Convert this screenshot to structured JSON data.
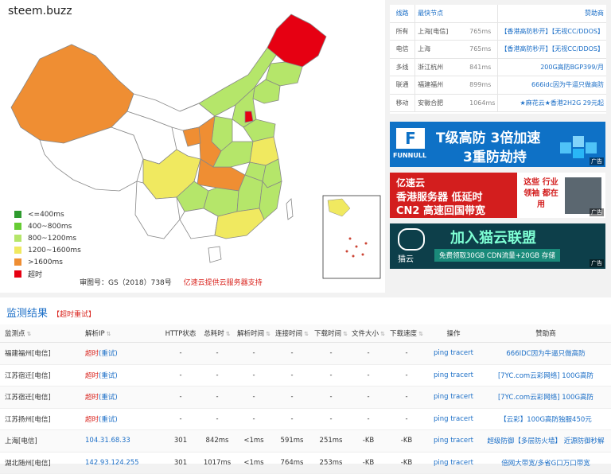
{
  "site": {
    "title": "steem.buzz"
  },
  "legend": [
    {
      "label": "<=400ms",
      "color": "#2e9b2e"
    },
    {
      "label": "400~800ms",
      "color": "#66cc33"
    },
    {
      "label": "800~1200ms",
      "color": "#b5e66a"
    },
    {
      "label": "1200~1600ms",
      "color": "#f0e960"
    },
    {
      "label": ">1600ms",
      "color": "#ef8e33"
    },
    {
      "label": "超时",
      "color": "#e60012"
    }
  ],
  "map_footer": {
    "license": "审图号：GS（2018）738号",
    "sponsor": "亿速云提供云服务器支持"
  },
  "lines_table": {
    "header": {
      "line": "线路",
      "node": "最快节点",
      "sponsor": "赞助商"
    },
    "rows": [
      {
        "line": "所有",
        "node": "上海[电信]",
        "time": "765ms",
        "sponsor": "【香港高防秒开】【无视CC/DDOS】"
      },
      {
        "line": "电信",
        "node": "上海",
        "time": "765ms",
        "sponsor": "【香港高防秒开】【无视CC/DDOS】"
      },
      {
        "line": "多线",
        "node": "浙江杭州",
        "time": "841ms",
        "sponsor": "200G高防BGP399/月"
      },
      {
        "line": "联通",
        "node": "福建福州",
        "time": "899ms",
        "sponsor": "666idc因为牛逼只做高防"
      },
      {
        "line": "移动",
        "node": "安徽合肥",
        "time": "1064ms",
        "sponsor": "★麻花云★香港2H2G 29元起"
      }
    ]
  },
  "ads": [
    {
      "brand": "FUNNULL",
      "headline": "T级高防  3倍加速",
      "sub": "3重防劫持",
      "tag": "广告"
    },
    {
      "brand": "亿速云",
      "headline": "香港服务器 低延时",
      "sub": "CN2 高速回国带宽",
      "side": "这些 行业领袖 都在用",
      "tag": "广告"
    },
    {
      "brand": "猫云",
      "headline": "加入猫云联盟",
      "sub": "免费领取30GB CDN流量+20GB 存储",
      "tag": "广告"
    }
  ],
  "results": {
    "title": "监测结果",
    "retry": "【超时重试】",
    "columns": [
      "监测点",
      "解析IP",
      "HTTP状态",
      "总耗时",
      "解析时间",
      "连接时间",
      "下载时间",
      "文件大小",
      "下载速度",
      "操作",
      "赞助商"
    ],
    "rows": [
      {
        "node": "福建福州[电信]",
        "ip": "超时",
        "retry": "(重试)",
        "status": "-",
        "total": "-",
        "resolve": "-",
        "connect": "-",
        "download": "-",
        "size": "-",
        "speed": "-",
        "ops": "ping tracert",
        "sponsor": "666IDC因为牛逼只做高防"
      },
      {
        "node": "江苏宿迁[电信]",
        "ip": "超时",
        "retry": "(重试)",
        "status": "-",
        "total": "-",
        "resolve": "-",
        "connect": "-",
        "download": "-",
        "size": "-",
        "speed": "-",
        "ops": "ping tracert",
        "sponsor": "[7YC.com云彩网络] 100G高防"
      },
      {
        "node": "江苏宿迁[电信]",
        "ip": "超时",
        "retry": "(重试)",
        "status": "-",
        "total": "-",
        "resolve": "-",
        "connect": "-",
        "download": "-",
        "size": "-",
        "speed": "-",
        "ops": "ping tracert",
        "sponsor": "[7YC.com云彩网络] 100G高防"
      },
      {
        "node": "江苏扬州[电信]",
        "ip": "超时",
        "retry": "(重试)",
        "status": "-",
        "total": "-",
        "resolve": "-",
        "connect": "-",
        "download": "-",
        "size": "-",
        "speed": "-",
        "ops": "ping tracert",
        "sponsor": "【云彩】100G高防独服450元"
      },
      {
        "node": "上海[电信]",
        "ip": "104.31.68.33",
        "retry": "",
        "status": "301",
        "total": "842ms",
        "resolve": "<1ms",
        "connect": "591ms",
        "download": "251ms",
        "size": "-KB",
        "speed": "-KB",
        "ops": "ping tracert",
        "sponsor": "超级防御【多层防火墙】 近源防御秒解"
      },
      {
        "node": "湖北随州[电信]",
        "ip": "142.93.124.255",
        "retry": "",
        "status": "301",
        "total": "1017ms",
        "resolve": "<1ms",
        "connect": "764ms",
        "download": "253ms",
        "size": "-KB",
        "speed": "-KB",
        "ops": "ping tracert",
        "sponsor": "倍网大带宽/多省G口万口带宽"
      }
    ]
  }
}
